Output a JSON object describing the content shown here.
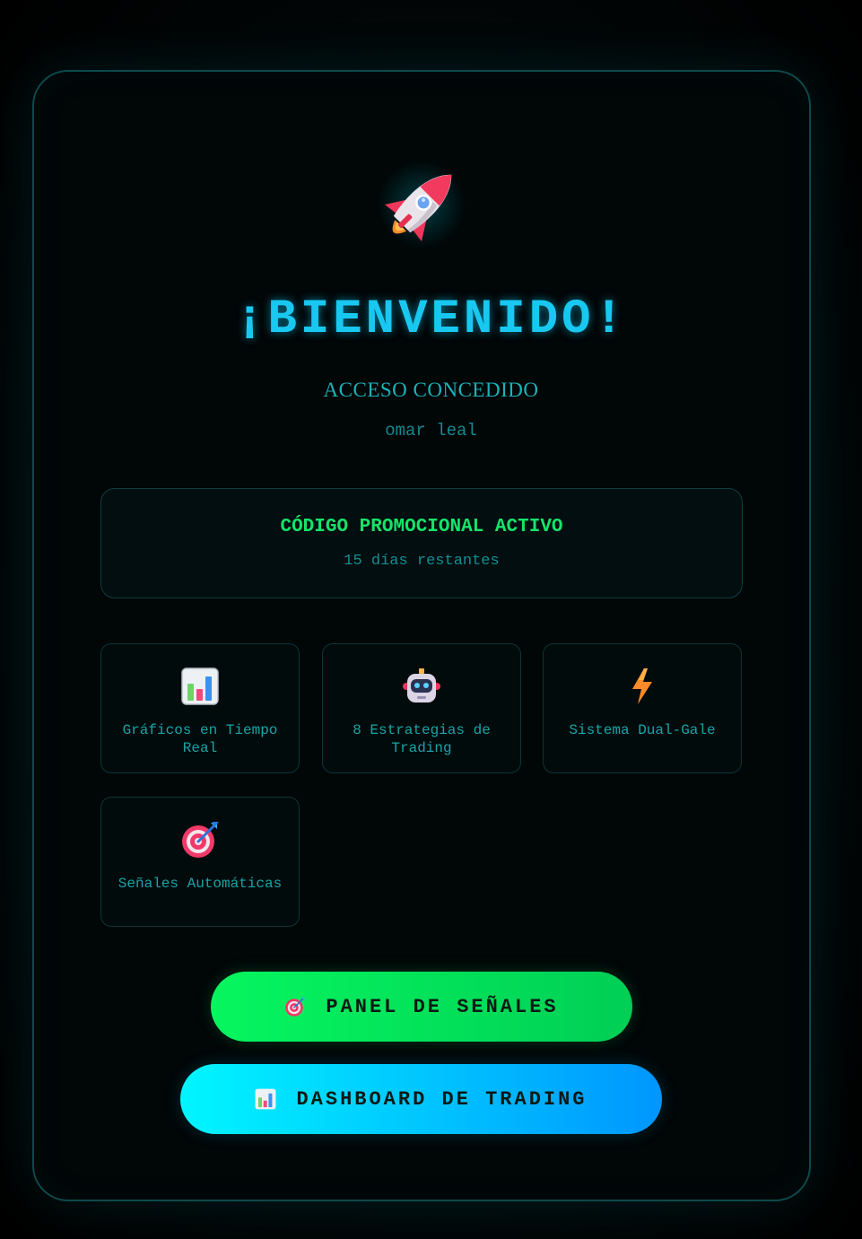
{
  "header": {
    "title": "¡BIENVENIDO!",
    "subtitle": "ACCESO CONCEDIDO",
    "username": "omar leal",
    "icon": "rocket-icon"
  },
  "promo": {
    "title": "CÓDIGO PROMOCIONAL ACTIVO",
    "days_remaining": "15 días restantes"
  },
  "features": [
    {
      "icon": "bar-chart-icon",
      "label": "Gráficos en Tiempo Real"
    },
    {
      "icon": "robot-icon",
      "label": "8 Estrategias de Trading"
    },
    {
      "icon": "lightning-icon",
      "label": "Sistema Dual-Gale"
    },
    {
      "icon": "target-icon",
      "label": "Señales Automáticas"
    }
  ],
  "buttons": {
    "signals": {
      "label": "PANEL DE SEÑALES",
      "icon": "target-icon"
    },
    "dashboard": {
      "label": "DASHBOARD DE TRADING",
      "icon": "bar-chart-icon"
    }
  },
  "colors": {
    "title": "#19c8f0",
    "accent_green": "#16e36a",
    "accent_teal": "#17a4a7",
    "button_green": "#06f65f",
    "button_blue": "#00c8ff"
  }
}
